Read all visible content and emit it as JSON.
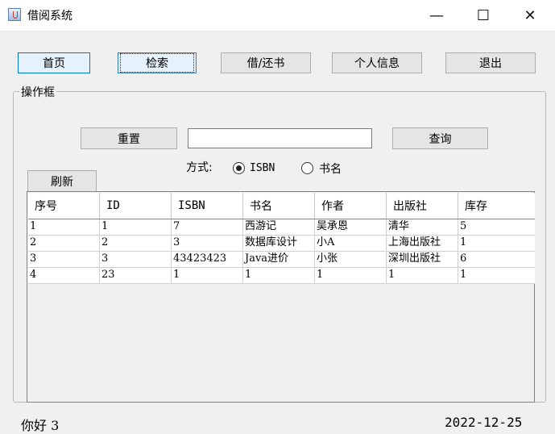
{
  "window": {
    "title": "借阅系统",
    "minimize": "—",
    "maximize": "☐",
    "close": "✕"
  },
  "nav": {
    "home": "首页",
    "search": "检索",
    "borrow_return": "借/还书",
    "profile": "个人信息",
    "exit": "退出"
  },
  "panel": {
    "label": "操作框",
    "reset": "重置",
    "query": "查询",
    "search_value": "",
    "mode_label": "方式:",
    "mode_isbn": "ISBN",
    "mode_title": "书名",
    "selected_mode": "ISBN",
    "refresh": "刷新"
  },
  "table": {
    "columns": [
      "序号",
      "ID",
      "ISBN",
      "书名",
      "作者",
      "出版社",
      "库存"
    ],
    "rows": [
      [
        "1",
        "1",
        "7",
        "西游记",
        "吴承恩",
        "清华",
        "5"
      ],
      [
        "2",
        "2",
        "3",
        "数据库设计",
        "小A",
        "上海出版社",
        "1"
      ],
      [
        "3",
        "3",
        "43423423",
        "Java进价",
        "小张",
        "深圳出版社",
        "6"
      ],
      [
        "4",
        "23",
        "1",
        "1",
        "1",
        "1",
        "1"
      ]
    ]
  },
  "status": {
    "greeting": "你好 3",
    "date": "2022-12-25"
  }
}
